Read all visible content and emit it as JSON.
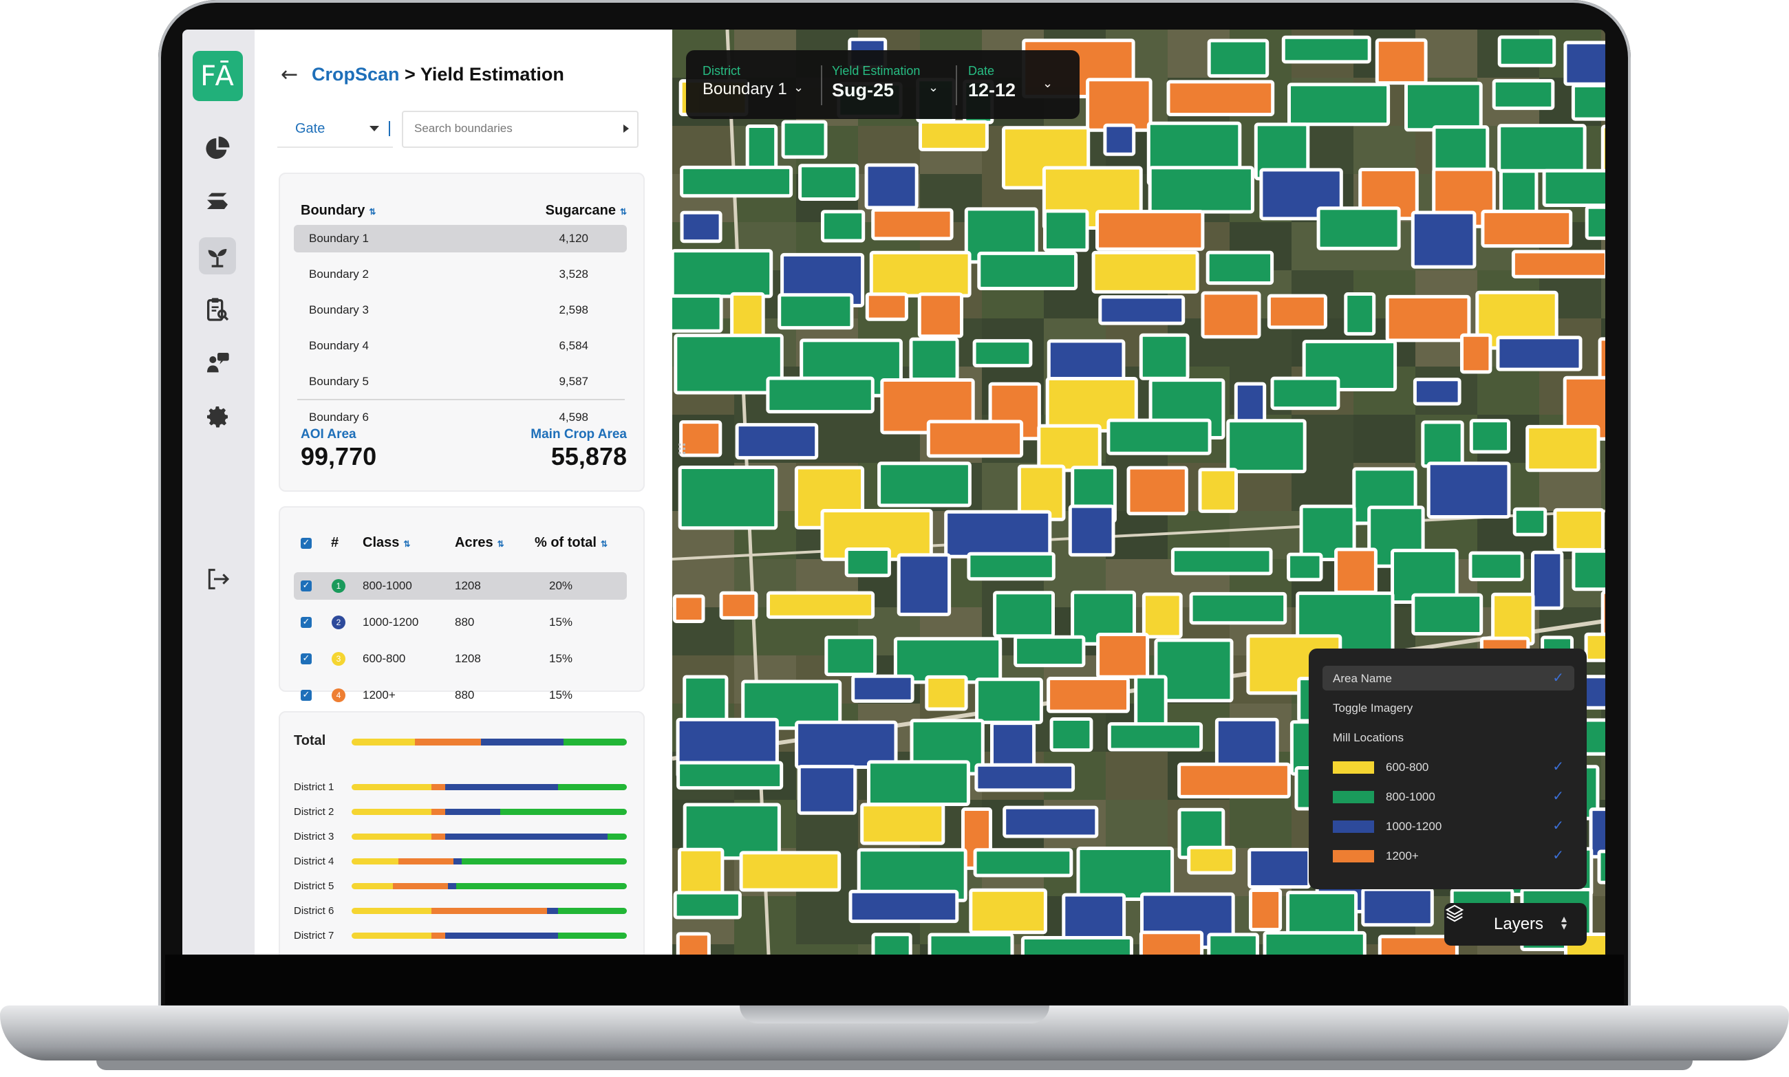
{
  "brand": {
    "logo_text": "FĀ"
  },
  "breadcrumb": {
    "app": "CropScan",
    "separator": ">",
    "page": "Yield Estimation"
  },
  "filter_row": {
    "gate_label": "Gate",
    "search_placeholder": "Search boundaries"
  },
  "boundary_table": {
    "col_boundary": "Boundary",
    "col_sugarcane": "Sugarcane",
    "rows": [
      {
        "name": "Boundary 1",
        "value": "4,120"
      },
      {
        "name": "Boundary 2",
        "value": "3,528"
      },
      {
        "name": "Boundary 3",
        "value": "2,598"
      },
      {
        "name": "Boundary 4",
        "value": "6,584"
      },
      {
        "name": "Boundary 5",
        "value": "9,587"
      },
      {
        "name": "Boundary 6",
        "value": "4,598"
      }
    ],
    "selected_index": 0
  },
  "summary": {
    "aoi_label": "AOI Area",
    "aoi_value": "99,770",
    "main_label": "Main Crop Area",
    "main_value": "55,878"
  },
  "class_table": {
    "col_num": "#",
    "col_class": "Class",
    "col_acres": "Acres",
    "col_pct": "% of total",
    "rows": [
      {
        "num": "1",
        "class": "800-1000",
        "acres": "1208",
        "pct": "20%",
        "color": "#1a9a5b",
        "checked": true
      },
      {
        "num": "2",
        "class": "1000-1200",
        "acres": "880",
        "pct": "15%",
        "color": "#2d4a9b",
        "checked": true
      },
      {
        "num": "3",
        "class": "600-800",
        "acres": "1208",
        "pct": "15%",
        "color": "#f5d531",
        "checked": true
      },
      {
        "num": "4",
        "class": "1200+",
        "acres": "880",
        "pct": "15%",
        "color": "#ee7e32",
        "checked": true
      }
    ],
    "selected_index": 0
  },
  "totals": {
    "total_label": "Total",
    "total_bar": [
      23,
      24,
      30,
      23
    ],
    "districts": [
      {
        "name": "District 1",
        "shares": [
          29,
          5,
          41,
          25
        ]
      },
      {
        "name": "District 2",
        "shares": [
          29,
          5,
          20,
          46
        ]
      },
      {
        "name": "District 3",
        "shares": [
          29,
          5,
          59,
          7
        ]
      },
      {
        "name": "District 4",
        "shares": [
          17,
          20,
          3,
          60
        ]
      },
      {
        "name": "District 5",
        "shares": [
          15,
          20,
          3,
          62
        ]
      },
      {
        "name": "District 6",
        "shares": [
          29,
          42,
          4,
          25
        ]
      },
      {
        "name": "District 7",
        "shares": [
          29,
          5,
          41,
          25
        ]
      }
    ],
    "segment_colors": [
      "#f5d531",
      "#ee7e32",
      "#2d4a9b",
      "#22b636"
    ]
  },
  "map_filters": {
    "district_label": "District",
    "district_value": "Boundary 1",
    "yield_label": "Yield Estimation",
    "yield_value": "Sug-25",
    "date_label": "Date",
    "date_value": "12-12"
  },
  "legend": {
    "area_name": "Area Name",
    "toggle_imagery": "Toggle Imagery",
    "mill_locations": "Mill Locations",
    "items": [
      {
        "label": "600-800",
        "color": "#f5d531",
        "checked": true
      },
      {
        "label": "800-1000",
        "color": "#1a9a5b",
        "checked": true
      },
      {
        "label": "1000-1200",
        "color": "#2d4a9b",
        "checked": true
      },
      {
        "label": "1200+",
        "color": "#ee7e32",
        "checked": true
      }
    ]
  },
  "layers_button": {
    "label": "Layers"
  },
  "icons": {
    "rail": [
      "pie-chart-icon",
      "layers-stack-icon",
      "sprout-icon",
      "clipboard-search-icon",
      "farmer-chat-icon",
      "gear-icon",
      "logout-icon"
    ],
    "map": [
      "chevron-down-icon",
      "check-icon",
      "layers-icon",
      "updown-icon",
      "drag-handle-icon"
    ]
  }
}
